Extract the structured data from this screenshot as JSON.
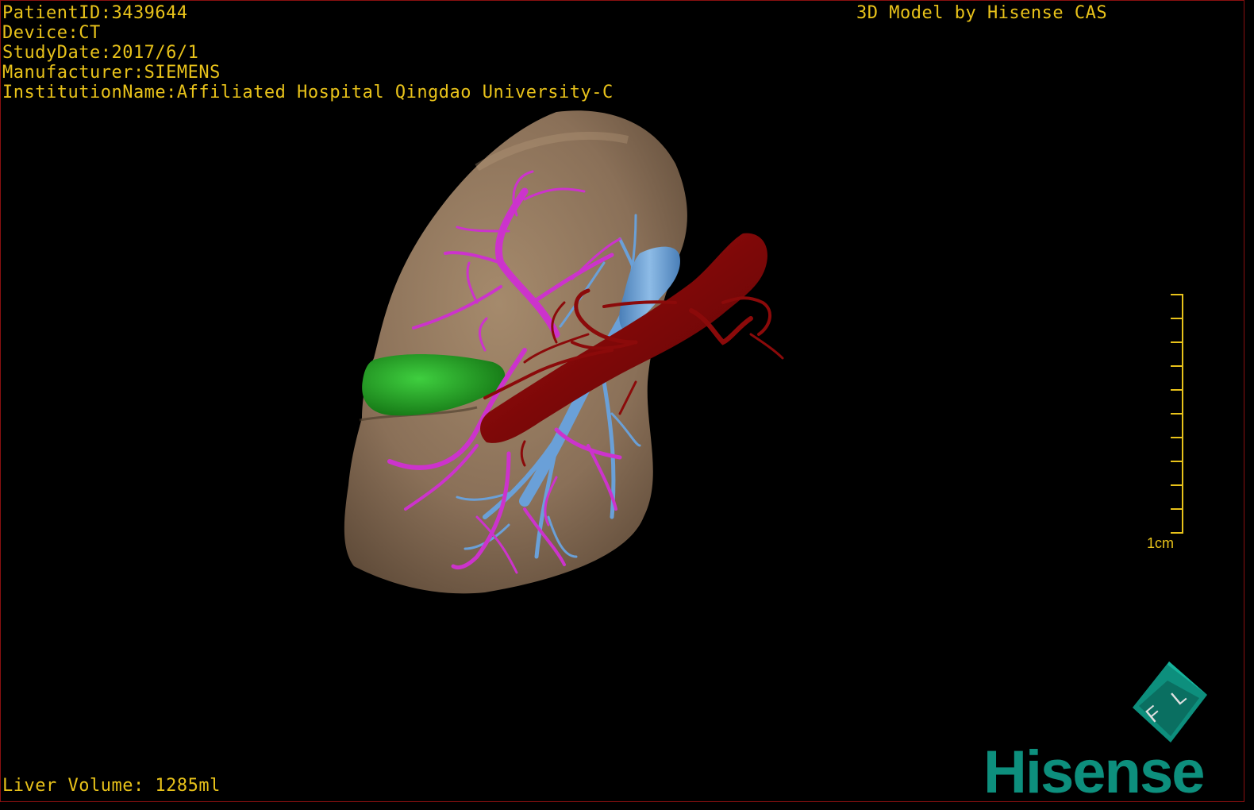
{
  "metadata": {
    "patient_id": "PatientID:3439644",
    "device": "Device:CT",
    "study_date": "StudyDate:2017/6/1",
    "manufacturer": "Manufacturer:SIEMENS",
    "institution": "InstitutionName:Affiliated Hospital Qingdao University-C"
  },
  "model_credit": "3D Model by Hisense CAS",
  "liver_volume": "Liver Volume: 1285ml",
  "scale_bar": {
    "label": "1cm",
    "tick_count": 10
  },
  "orientation_cube": {
    "face_letters": [
      "F",
      "L"
    ]
  },
  "brand": {
    "name": "Hisense",
    "color": "#0d8f7d"
  },
  "colors": {
    "overlay_text": "#e8c21a",
    "liver": "#8a7058",
    "hepatic_vein": "#cc33cc",
    "portal_vein": "#6aa0d8",
    "artery": "#8b0a0a",
    "gallbladder": "#22a022"
  }
}
